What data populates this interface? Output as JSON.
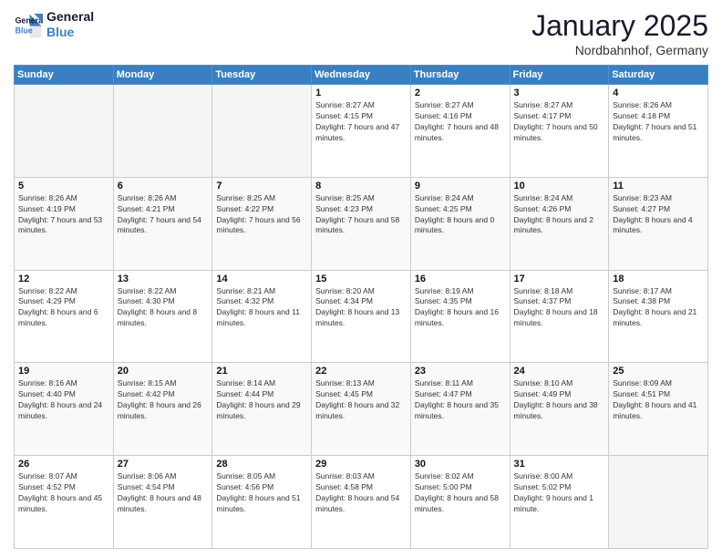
{
  "header": {
    "logo_line1": "General",
    "logo_line2": "Blue",
    "month_title": "January 2025",
    "location": "Nordbahnhof, Germany"
  },
  "weekdays": [
    "Sunday",
    "Monday",
    "Tuesday",
    "Wednesday",
    "Thursday",
    "Friday",
    "Saturday"
  ],
  "weeks": [
    [
      {
        "day": "",
        "info": ""
      },
      {
        "day": "",
        "info": ""
      },
      {
        "day": "",
        "info": ""
      },
      {
        "day": "1",
        "info": "Sunrise: 8:27 AM\nSunset: 4:15 PM\nDaylight: 7 hours and 47 minutes."
      },
      {
        "day": "2",
        "info": "Sunrise: 8:27 AM\nSunset: 4:16 PM\nDaylight: 7 hours and 48 minutes."
      },
      {
        "day": "3",
        "info": "Sunrise: 8:27 AM\nSunset: 4:17 PM\nDaylight: 7 hours and 50 minutes."
      },
      {
        "day": "4",
        "info": "Sunrise: 8:26 AM\nSunset: 4:18 PM\nDaylight: 7 hours and 51 minutes."
      }
    ],
    [
      {
        "day": "5",
        "info": "Sunrise: 8:26 AM\nSunset: 4:19 PM\nDaylight: 7 hours and 53 minutes."
      },
      {
        "day": "6",
        "info": "Sunrise: 8:26 AM\nSunset: 4:21 PM\nDaylight: 7 hours and 54 minutes."
      },
      {
        "day": "7",
        "info": "Sunrise: 8:25 AM\nSunset: 4:22 PM\nDaylight: 7 hours and 56 minutes."
      },
      {
        "day": "8",
        "info": "Sunrise: 8:25 AM\nSunset: 4:23 PM\nDaylight: 7 hours and 58 minutes."
      },
      {
        "day": "9",
        "info": "Sunrise: 8:24 AM\nSunset: 4:25 PM\nDaylight: 8 hours and 0 minutes."
      },
      {
        "day": "10",
        "info": "Sunrise: 8:24 AM\nSunset: 4:26 PM\nDaylight: 8 hours and 2 minutes."
      },
      {
        "day": "11",
        "info": "Sunrise: 8:23 AM\nSunset: 4:27 PM\nDaylight: 8 hours and 4 minutes."
      }
    ],
    [
      {
        "day": "12",
        "info": "Sunrise: 8:22 AM\nSunset: 4:29 PM\nDaylight: 8 hours and 6 minutes."
      },
      {
        "day": "13",
        "info": "Sunrise: 8:22 AM\nSunset: 4:30 PM\nDaylight: 8 hours and 8 minutes."
      },
      {
        "day": "14",
        "info": "Sunrise: 8:21 AM\nSunset: 4:32 PM\nDaylight: 8 hours and 11 minutes."
      },
      {
        "day": "15",
        "info": "Sunrise: 8:20 AM\nSunset: 4:34 PM\nDaylight: 8 hours and 13 minutes."
      },
      {
        "day": "16",
        "info": "Sunrise: 8:19 AM\nSunset: 4:35 PM\nDaylight: 8 hours and 16 minutes."
      },
      {
        "day": "17",
        "info": "Sunrise: 8:18 AM\nSunset: 4:37 PM\nDaylight: 8 hours and 18 minutes."
      },
      {
        "day": "18",
        "info": "Sunrise: 8:17 AM\nSunset: 4:38 PM\nDaylight: 8 hours and 21 minutes."
      }
    ],
    [
      {
        "day": "19",
        "info": "Sunrise: 8:16 AM\nSunset: 4:40 PM\nDaylight: 8 hours and 24 minutes."
      },
      {
        "day": "20",
        "info": "Sunrise: 8:15 AM\nSunset: 4:42 PM\nDaylight: 8 hours and 26 minutes."
      },
      {
        "day": "21",
        "info": "Sunrise: 8:14 AM\nSunset: 4:44 PM\nDaylight: 8 hours and 29 minutes."
      },
      {
        "day": "22",
        "info": "Sunrise: 8:13 AM\nSunset: 4:45 PM\nDaylight: 8 hours and 32 minutes."
      },
      {
        "day": "23",
        "info": "Sunrise: 8:11 AM\nSunset: 4:47 PM\nDaylight: 8 hours and 35 minutes."
      },
      {
        "day": "24",
        "info": "Sunrise: 8:10 AM\nSunset: 4:49 PM\nDaylight: 8 hours and 38 minutes."
      },
      {
        "day": "25",
        "info": "Sunrise: 8:09 AM\nSunset: 4:51 PM\nDaylight: 8 hours and 41 minutes."
      }
    ],
    [
      {
        "day": "26",
        "info": "Sunrise: 8:07 AM\nSunset: 4:52 PM\nDaylight: 8 hours and 45 minutes."
      },
      {
        "day": "27",
        "info": "Sunrise: 8:06 AM\nSunset: 4:54 PM\nDaylight: 8 hours and 48 minutes."
      },
      {
        "day": "28",
        "info": "Sunrise: 8:05 AM\nSunset: 4:56 PM\nDaylight: 8 hours and 51 minutes."
      },
      {
        "day": "29",
        "info": "Sunrise: 8:03 AM\nSunset: 4:58 PM\nDaylight: 8 hours and 54 minutes."
      },
      {
        "day": "30",
        "info": "Sunrise: 8:02 AM\nSunset: 5:00 PM\nDaylight: 8 hours and 58 minutes."
      },
      {
        "day": "31",
        "info": "Sunrise: 8:00 AM\nSunset: 5:02 PM\nDaylight: 9 hours and 1 minute."
      },
      {
        "day": "",
        "info": ""
      }
    ]
  ]
}
